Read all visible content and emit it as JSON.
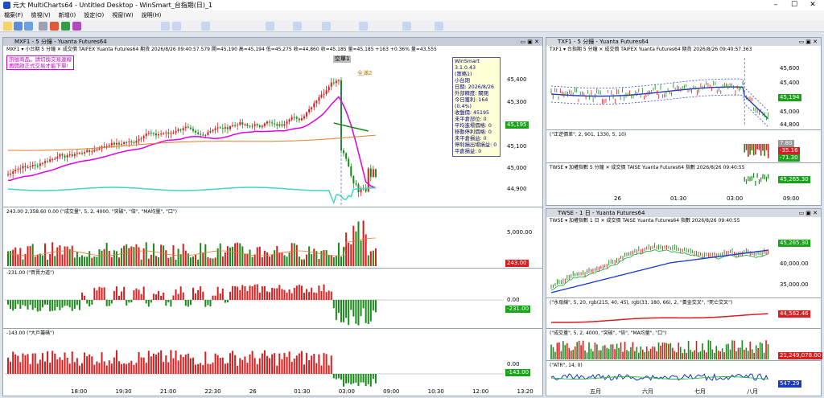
{
  "window": {
    "title": "元大 MultiCharts64 - Untitled Desktop - WinSmart_台指期(日)_1"
  },
  "menu": [
    "檔案(F)",
    "檢視(V)",
    "新增(I)",
    "設定(O)",
    "視窗(W)",
    "說明(H)"
  ],
  "left_chart": {
    "tab_title": "MXF1 - 5 分鐘 - Yuanta Futures64",
    "info": "MXF1 ▾  小台期  5 分鐘  ✕  成交價  TAIFEX  Yuanta Futures64  期貨  2026/8/26  09:40:57.579  開=45,190  高=45,194  低=45,275  收=44,860  收=45,185  量=45,185  +163  +0.36%  量=43,555",
    "alert_lines": [
      "訊號商品，請切換交易連線",
      "再開啟正式交易才能下單!"
    ],
    "stats": {
      "title": "WinSmart 3.1.0.43",
      "lines": [
        "(策略1)",
        "小台期",
        "日期: 2026/8/26",
        "外部精度: 關閉",
        "今日獲利: 164 (0.4%)",
        "收盤價: 45195",
        "未平倉部位: 0",
        "平均進場價格: 0",
        "移動停利價格: 0",
        "未平倉損益: 0",
        "停利損出場損益: 0",
        "平倉損益: 0"
      ]
    },
    "markers": {
      "peak": "空單1",
      "mid": "全滿2"
    },
    "price_axis": [
      "45,400",
      "45,300",
      "45,100",
      "45,000",
      "44,900"
    ],
    "price_last": "45,195",
    "volume": {
      "info": "243.00  2,358.60  0.00  (\"成交量\", 5, 2, 4000, \"突破\", \"倍\", \"MA均量\", \"口\")",
      "axis": "5,000.00",
      "last": "243.00"
    },
    "buysell": {
      "info": "-231.00  (\"買賣力道\")",
      "axis": "0.00",
      "last": "-231.00"
    },
    "bigtrader": {
      "info": "-143.00  (\"大戶籌碼\")",
      "axis": "0.00",
      "last": "-143.00"
    },
    "time_axis": [
      "18:00",
      "19:30",
      "21:00",
      "22:30",
      "26",
      "01:30",
      "03:00",
      "09:00",
      "10:30",
      "12:00",
      "13:20"
    ]
  },
  "right_top": {
    "tab_title": "TXF1 - 5 分鐘 - Yuanta Futures64",
    "info": "TXF1 ▾  台指期  5 分鐘  ✕  成交價  TAIFEX  Yuanta Futures64  期貨  2026/8/26  09:40:57.363",
    "price_axis": [
      "45,600",
      "45,400",
      "45,000",
      "44,800"
    ],
    "price_last": "45,194",
    "sub1_info": "(\"正逆價差\", 2, 901, 1330, 5, 10)",
    "sub1_tags": [
      "7.80",
      "-35.16",
      "-71.30"
    ],
    "sub2_info": "TWSE ▾  加權指數  5 分鐘  ✕  成交價  TAISE  Yuanta Futures64  指數  2026/8/26  09:40:55",
    "sub2_last": "45,265.30",
    "time_axis": [
      "26",
      "01:30",
      "03:00",
      "09:00"
    ]
  },
  "right_bottom": {
    "tab_title": "TWSE - 1 日 - Yuanta Futures64",
    "info": "TWSE ▾  加權指數  1 日  ✕  成交價  TAISE  Yuanta Futures64  指數  2026/8/26  09:40:55",
    "price_axis": [
      "45,000.00",
      "40,000.00",
      "35,000.00",
      "30,000.00"
    ],
    "price_last": "45,265.30",
    "sub1_info": "(\"水母線\", 5, 20, rgb(215, 40, 45), rgb(33, 180, 66), 2, \"黃金交叉\", \"死亡交叉\")",
    "sub1_last": "44,562.46",
    "sub2_info": "(\"成交量\", 5, 2, 4000, \"突破\", \"倍\", \"MA均量\", \"口\")",
    "sub2_last": "21,249,078.00",
    "sub3_info": "(\"ATR\", 14, 0)",
    "sub3_last": "547.29",
    "time_axis": [
      "五月",
      "六月",
      "七月",
      "八月"
    ]
  },
  "colors": {
    "up": "#d81e1e",
    "down": "#1a8a1a",
    "magenta": "#e000e0",
    "cyan": "#3fd6c8",
    "orange": "#e67a2a",
    "blue": "#1836c8",
    "bg": "#ffffff"
  }
}
